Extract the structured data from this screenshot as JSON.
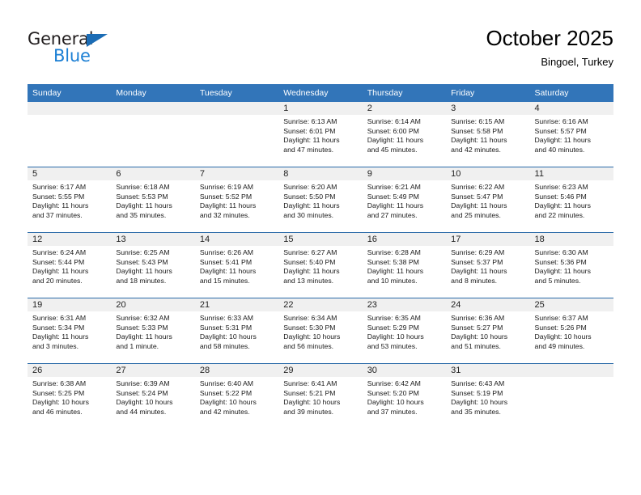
{
  "brand": {
    "name_part1": "General",
    "name_part2": "Blue",
    "accent_color": "#1b7fd4",
    "triangle_color": "#1b6cb5"
  },
  "header": {
    "title": "October 2025",
    "subtitle": "Bingoel, Turkey"
  },
  "theme": {
    "header_row_bg": "#3275b9",
    "row_divider": "#2a6aa8",
    "daynum_band_bg": "#f0f0f0"
  },
  "weekday_headers": [
    "Sunday",
    "Monday",
    "Tuesday",
    "Wednesday",
    "Thursday",
    "Friday",
    "Saturday"
  ],
  "labels": {
    "sunrise_prefix": "Sunrise:",
    "sunset_prefix": "Sunset:",
    "daylight_prefix": "Daylight:"
  },
  "weeks": [
    [
      {
        "day": "",
        "empty": true,
        "sunrise": "",
        "sunset": "",
        "daylight_line1": "",
        "daylight_line2": ""
      },
      {
        "day": "",
        "empty": true,
        "sunrise": "",
        "sunset": "",
        "daylight_line1": "",
        "daylight_line2": ""
      },
      {
        "day": "",
        "empty": true,
        "sunrise": "",
        "sunset": "",
        "daylight_line1": "",
        "daylight_line2": ""
      },
      {
        "day": "1",
        "empty": false,
        "sunrise": "Sunrise: 6:13 AM",
        "sunset": "Sunset: 6:01 PM",
        "daylight_line1": "Daylight: 11 hours",
        "daylight_line2": "and 47 minutes."
      },
      {
        "day": "2",
        "empty": false,
        "sunrise": "Sunrise: 6:14 AM",
        "sunset": "Sunset: 6:00 PM",
        "daylight_line1": "Daylight: 11 hours",
        "daylight_line2": "and 45 minutes."
      },
      {
        "day": "3",
        "empty": false,
        "sunrise": "Sunrise: 6:15 AM",
        "sunset": "Sunset: 5:58 PM",
        "daylight_line1": "Daylight: 11 hours",
        "daylight_line2": "and 42 minutes."
      },
      {
        "day": "4",
        "empty": false,
        "sunrise": "Sunrise: 6:16 AM",
        "sunset": "Sunset: 5:57 PM",
        "daylight_line1": "Daylight: 11 hours",
        "daylight_line2": "and 40 minutes."
      }
    ],
    [
      {
        "day": "5",
        "empty": false,
        "sunrise": "Sunrise: 6:17 AM",
        "sunset": "Sunset: 5:55 PM",
        "daylight_line1": "Daylight: 11 hours",
        "daylight_line2": "and 37 minutes."
      },
      {
        "day": "6",
        "empty": false,
        "sunrise": "Sunrise: 6:18 AM",
        "sunset": "Sunset: 5:53 PM",
        "daylight_line1": "Daylight: 11 hours",
        "daylight_line2": "and 35 minutes."
      },
      {
        "day": "7",
        "empty": false,
        "sunrise": "Sunrise: 6:19 AM",
        "sunset": "Sunset: 5:52 PM",
        "daylight_line1": "Daylight: 11 hours",
        "daylight_line2": "and 32 minutes."
      },
      {
        "day": "8",
        "empty": false,
        "sunrise": "Sunrise: 6:20 AM",
        "sunset": "Sunset: 5:50 PM",
        "daylight_line1": "Daylight: 11 hours",
        "daylight_line2": "and 30 minutes."
      },
      {
        "day": "9",
        "empty": false,
        "sunrise": "Sunrise: 6:21 AM",
        "sunset": "Sunset: 5:49 PM",
        "daylight_line1": "Daylight: 11 hours",
        "daylight_line2": "and 27 minutes."
      },
      {
        "day": "10",
        "empty": false,
        "sunrise": "Sunrise: 6:22 AM",
        "sunset": "Sunset: 5:47 PM",
        "daylight_line1": "Daylight: 11 hours",
        "daylight_line2": "and 25 minutes."
      },
      {
        "day": "11",
        "empty": false,
        "sunrise": "Sunrise: 6:23 AM",
        "sunset": "Sunset: 5:46 PM",
        "daylight_line1": "Daylight: 11 hours",
        "daylight_line2": "and 22 minutes."
      }
    ],
    [
      {
        "day": "12",
        "empty": false,
        "sunrise": "Sunrise: 6:24 AM",
        "sunset": "Sunset: 5:44 PM",
        "daylight_line1": "Daylight: 11 hours",
        "daylight_line2": "and 20 minutes."
      },
      {
        "day": "13",
        "empty": false,
        "sunrise": "Sunrise: 6:25 AM",
        "sunset": "Sunset: 5:43 PM",
        "daylight_line1": "Daylight: 11 hours",
        "daylight_line2": "and 18 minutes."
      },
      {
        "day": "14",
        "empty": false,
        "sunrise": "Sunrise: 6:26 AM",
        "sunset": "Sunset: 5:41 PM",
        "daylight_line1": "Daylight: 11 hours",
        "daylight_line2": "and 15 minutes."
      },
      {
        "day": "15",
        "empty": false,
        "sunrise": "Sunrise: 6:27 AM",
        "sunset": "Sunset: 5:40 PM",
        "daylight_line1": "Daylight: 11 hours",
        "daylight_line2": "and 13 minutes."
      },
      {
        "day": "16",
        "empty": false,
        "sunrise": "Sunrise: 6:28 AM",
        "sunset": "Sunset: 5:38 PM",
        "daylight_line1": "Daylight: 11 hours",
        "daylight_line2": "and 10 minutes."
      },
      {
        "day": "17",
        "empty": false,
        "sunrise": "Sunrise: 6:29 AM",
        "sunset": "Sunset: 5:37 PM",
        "daylight_line1": "Daylight: 11 hours",
        "daylight_line2": "and 8 minutes."
      },
      {
        "day": "18",
        "empty": false,
        "sunrise": "Sunrise: 6:30 AM",
        "sunset": "Sunset: 5:36 PM",
        "daylight_line1": "Daylight: 11 hours",
        "daylight_line2": "and 5 minutes."
      }
    ],
    [
      {
        "day": "19",
        "empty": false,
        "sunrise": "Sunrise: 6:31 AM",
        "sunset": "Sunset: 5:34 PM",
        "daylight_line1": "Daylight: 11 hours",
        "daylight_line2": "and 3 minutes."
      },
      {
        "day": "20",
        "empty": false,
        "sunrise": "Sunrise: 6:32 AM",
        "sunset": "Sunset: 5:33 PM",
        "daylight_line1": "Daylight: 11 hours",
        "daylight_line2": "and 1 minute."
      },
      {
        "day": "21",
        "empty": false,
        "sunrise": "Sunrise: 6:33 AM",
        "sunset": "Sunset: 5:31 PM",
        "daylight_line1": "Daylight: 10 hours",
        "daylight_line2": "and 58 minutes."
      },
      {
        "day": "22",
        "empty": false,
        "sunrise": "Sunrise: 6:34 AM",
        "sunset": "Sunset: 5:30 PM",
        "daylight_line1": "Daylight: 10 hours",
        "daylight_line2": "and 56 minutes."
      },
      {
        "day": "23",
        "empty": false,
        "sunrise": "Sunrise: 6:35 AM",
        "sunset": "Sunset: 5:29 PM",
        "daylight_line1": "Daylight: 10 hours",
        "daylight_line2": "and 53 minutes."
      },
      {
        "day": "24",
        "empty": false,
        "sunrise": "Sunrise: 6:36 AM",
        "sunset": "Sunset: 5:27 PM",
        "daylight_line1": "Daylight: 10 hours",
        "daylight_line2": "and 51 minutes."
      },
      {
        "day": "25",
        "empty": false,
        "sunrise": "Sunrise: 6:37 AM",
        "sunset": "Sunset: 5:26 PM",
        "daylight_line1": "Daylight: 10 hours",
        "daylight_line2": "and 49 minutes."
      }
    ],
    [
      {
        "day": "26",
        "empty": false,
        "sunrise": "Sunrise: 6:38 AM",
        "sunset": "Sunset: 5:25 PM",
        "daylight_line1": "Daylight: 10 hours",
        "daylight_line2": "and 46 minutes."
      },
      {
        "day": "27",
        "empty": false,
        "sunrise": "Sunrise: 6:39 AM",
        "sunset": "Sunset: 5:24 PM",
        "daylight_line1": "Daylight: 10 hours",
        "daylight_line2": "and 44 minutes."
      },
      {
        "day": "28",
        "empty": false,
        "sunrise": "Sunrise: 6:40 AM",
        "sunset": "Sunset: 5:22 PM",
        "daylight_line1": "Daylight: 10 hours",
        "daylight_line2": "and 42 minutes."
      },
      {
        "day": "29",
        "empty": false,
        "sunrise": "Sunrise: 6:41 AM",
        "sunset": "Sunset: 5:21 PM",
        "daylight_line1": "Daylight: 10 hours",
        "daylight_line2": "and 39 minutes."
      },
      {
        "day": "30",
        "empty": false,
        "sunrise": "Sunrise: 6:42 AM",
        "sunset": "Sunset: 5:20 PM",
        "daylight_line1": "Daylight: 10 hours",
        "daylight_line2": "and 37 minutes."
      },
      {
        "day": "31",
        "empty": false,
        "sunrise": "Sunrise: 6:43 AM",
        "sunset": "Sunset: 5:19 PM",
        "daylight_line1": "Daylight: 10 hours",
        "daylight_line2": "and 35 minutes."
      },
      {
        "day": "",
        "empty": true,
        "sunrise": "",
        "sunset": "",
        "daylight_line1": "",
        "daylight_line2": ""
      }
    ]
  ]
}
